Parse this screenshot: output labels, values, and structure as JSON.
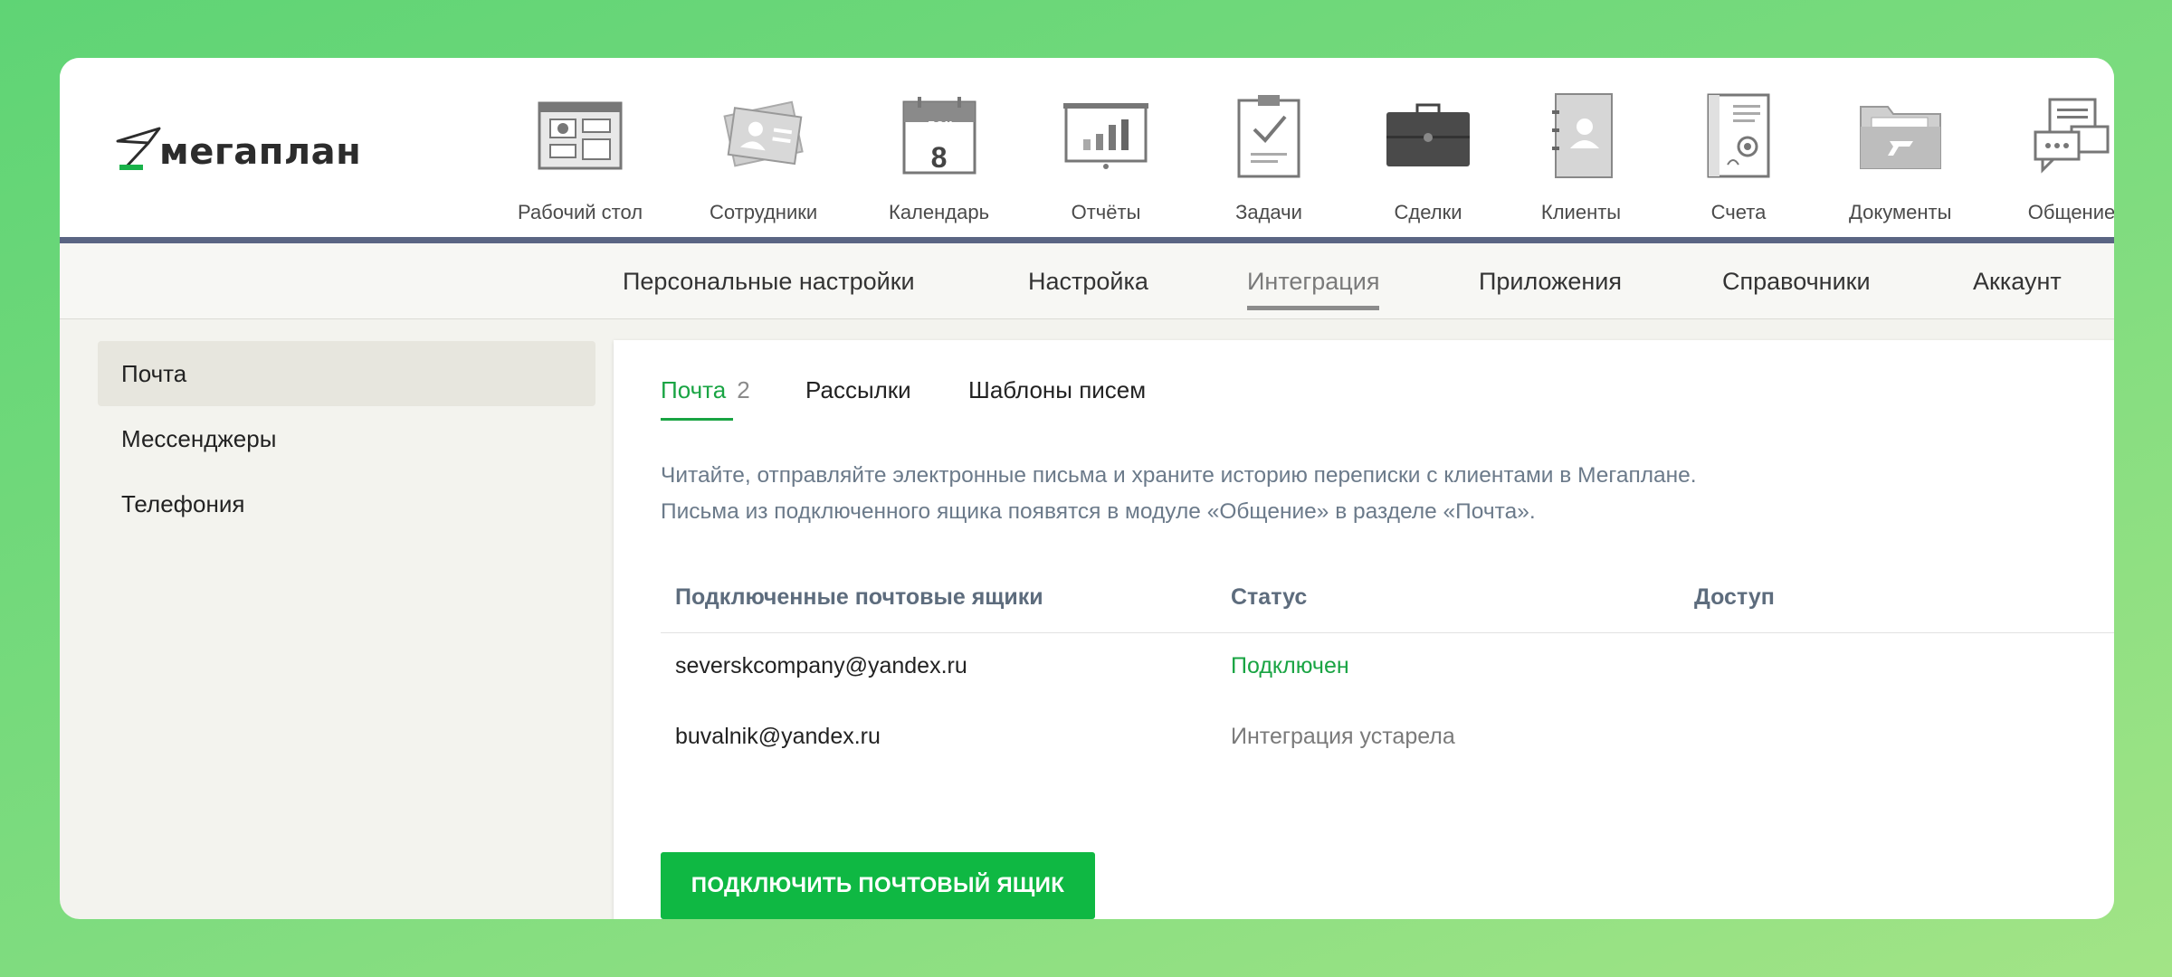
{
  "logo": {
    "text": "мегаплан"
  },
  "modules": [
    {
      "label": "Рабочий стол",
      "icon": "dashboard-icon"
    },
    {
      "label": "Сотрудники",
      "icon": "employees-icon"
    },
    {
      "label": "Календарь",
      "icon": "calendar-icon",
      "month": "дек",
      "day": "8"
    },
    {
      "label": "Отчёты",
      "icon": "reports-icon"
    },
    {
      "label": "Задачи",
      "icon": "tasks-icon"
    },
    {
      "label": "Сделки",
      "icon": "deals-icon"
    },
    {
      "label": "Клиенты",
      "icon": "clients-icon"
    },
    {
      "label": "Счета",
      "icon": "invoices-icon"
    },
    {
      "label": "Документы",
      "icon": "documents-icon"
    },
    {
      "label": "Общение",
      "icon": "chat-icon"
    }
  ],
  "subnav": [
    {
      "label": "Персональные настройки"
    },
    {
      "label": "Настройка"
    },
    {
      "label": "Интеграция",
      "active": true
    },
    {
      "label": "Приложения"
    },
    {
      "label": "Справочники"
    },
    {
      "label": "Аккаунт"
    }
  ],
  "sidebar": [
    {
      "label": "Почта",
      "active": true
    },
    {
      "label": "Мессенджеры"
    },
    {
      "label": "Телефония"
    }
  ],
  "tabs": [
    {
      "label": "Почта",
      "count": "2",
      "active": true
    },
    {
      "label": "Рассылки"
    },
    {
      "label": "Шаблоны писем"
    }
  ],
  "description": {
    "line1": "Читайте, отправляйте электронные письма и храните историю переписки с клиентами в Мегаплане.",
    "line2": "Письма из подключенного ящика появятся в модуле «Общение» в разделе «Почта»."
  },
  "table": {
    "headers": [
      "Подключенные почтовые ящики",
      "Статус",
      "Доступ"
    ],
    "rows": [
      {
        "email": "severskcompany@yandex.ru",
        "status": "Подключен",
        "access": ""
      },
      {
        "email": "buvalnik@yandex.ru",
        "status": "Интеграция устарела",
        "access": ""
      }
    ]
  },
  "button": {
    "label": "ПОДКЛЮЧИТЬ ПОЧТОВЫЙ ЯЩИК"
  },
  "colors": {
    "accent": "#0fb843",
    "status_ok": "#19a443",
    "header_line": "#5a6583",
    "background_gradient_start": "#5fd475",
    "background_gradient_end": "#a2e486"
  }
}
